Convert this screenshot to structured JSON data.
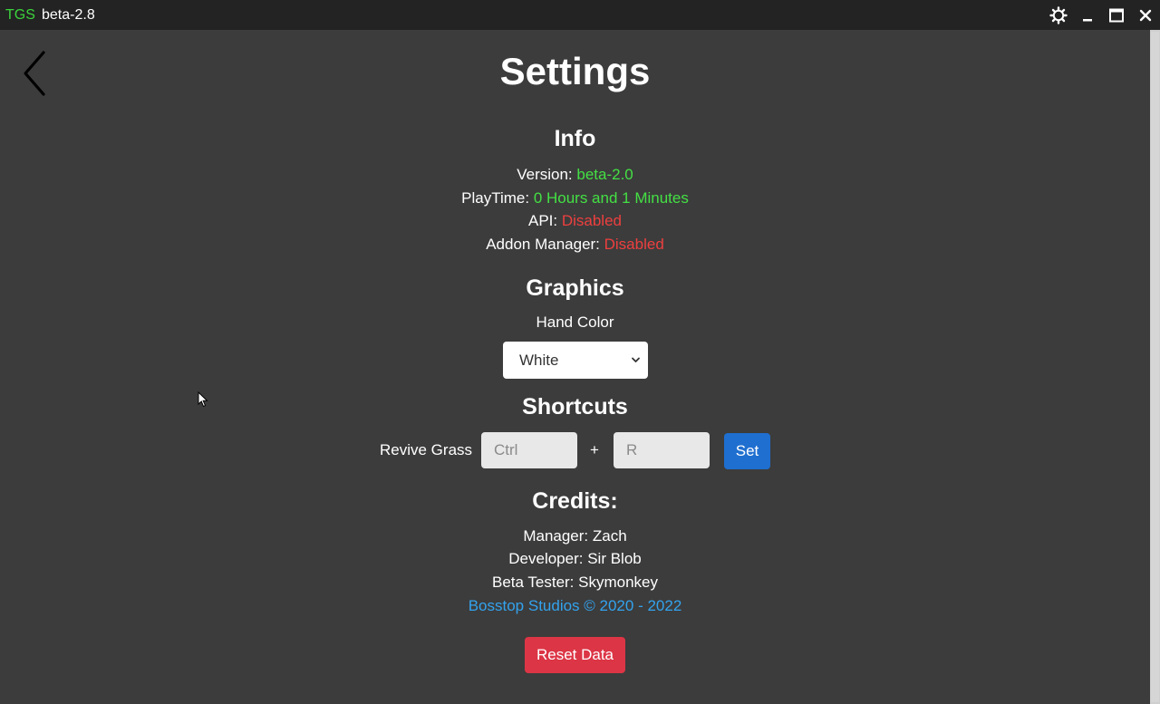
{
  "titlebar": {
    "app_name": "TGS",
    "version": "beta-2.8",
    "icons": [
      "gear-icon",
      "minimize-icon",
      "maximize-icon",
      "close-icon"
    ]
  },
  "page": {
    "title": "Settings",
    "back_icon": "chevron-left-icon"
  },
  "info": {
    "heading": "Info",
    "version_label": "Version: ",
    "version_value": "beta-2.0",
    "playtime_label": "PlayTime: ",
    "playtime_value": "0 Hours and 1 Minutes",
    "api_label": "API: ",
    "api_value": "Disabled",
    "addon_label": "Addon Manager: ",
    "addon_value": "Disabled"
  },
  "graphics": {
    "heading": "Graphics",
    "hand_color_label": "Hand Color",
    "hand_color_selected": "White"
  },
  "shortcuts": {
    "heading": "Shortcuts",
    "revive_label": "Revive Grass",
    "modifier_placeholder": "Ctrl",
    "plus": "+",
    "key_placeholder": "R",
    "set_label": "Set"
  },
  "credits": {
    "heading": "Credits:",
    "manager": "Manager: Zach",
    "developer": "Developer: Sir Blob",
    "tester": "Beta Tester: Skymonkey",
    "copyright": "Bosstop Studios © 2020 - 2022"
  },
  "reset_label": "Reset Data",
  "colors": {
    "background": "#3c3c3c",
    "titlebar": "#232323",
    "success": "#44e044",
    "danger_text": "#ee3f3f",
    "link": "#33a3ee",
    "primary_button": "#1f6fd0",
    "danger_button": "#dc3545"
  }
}
